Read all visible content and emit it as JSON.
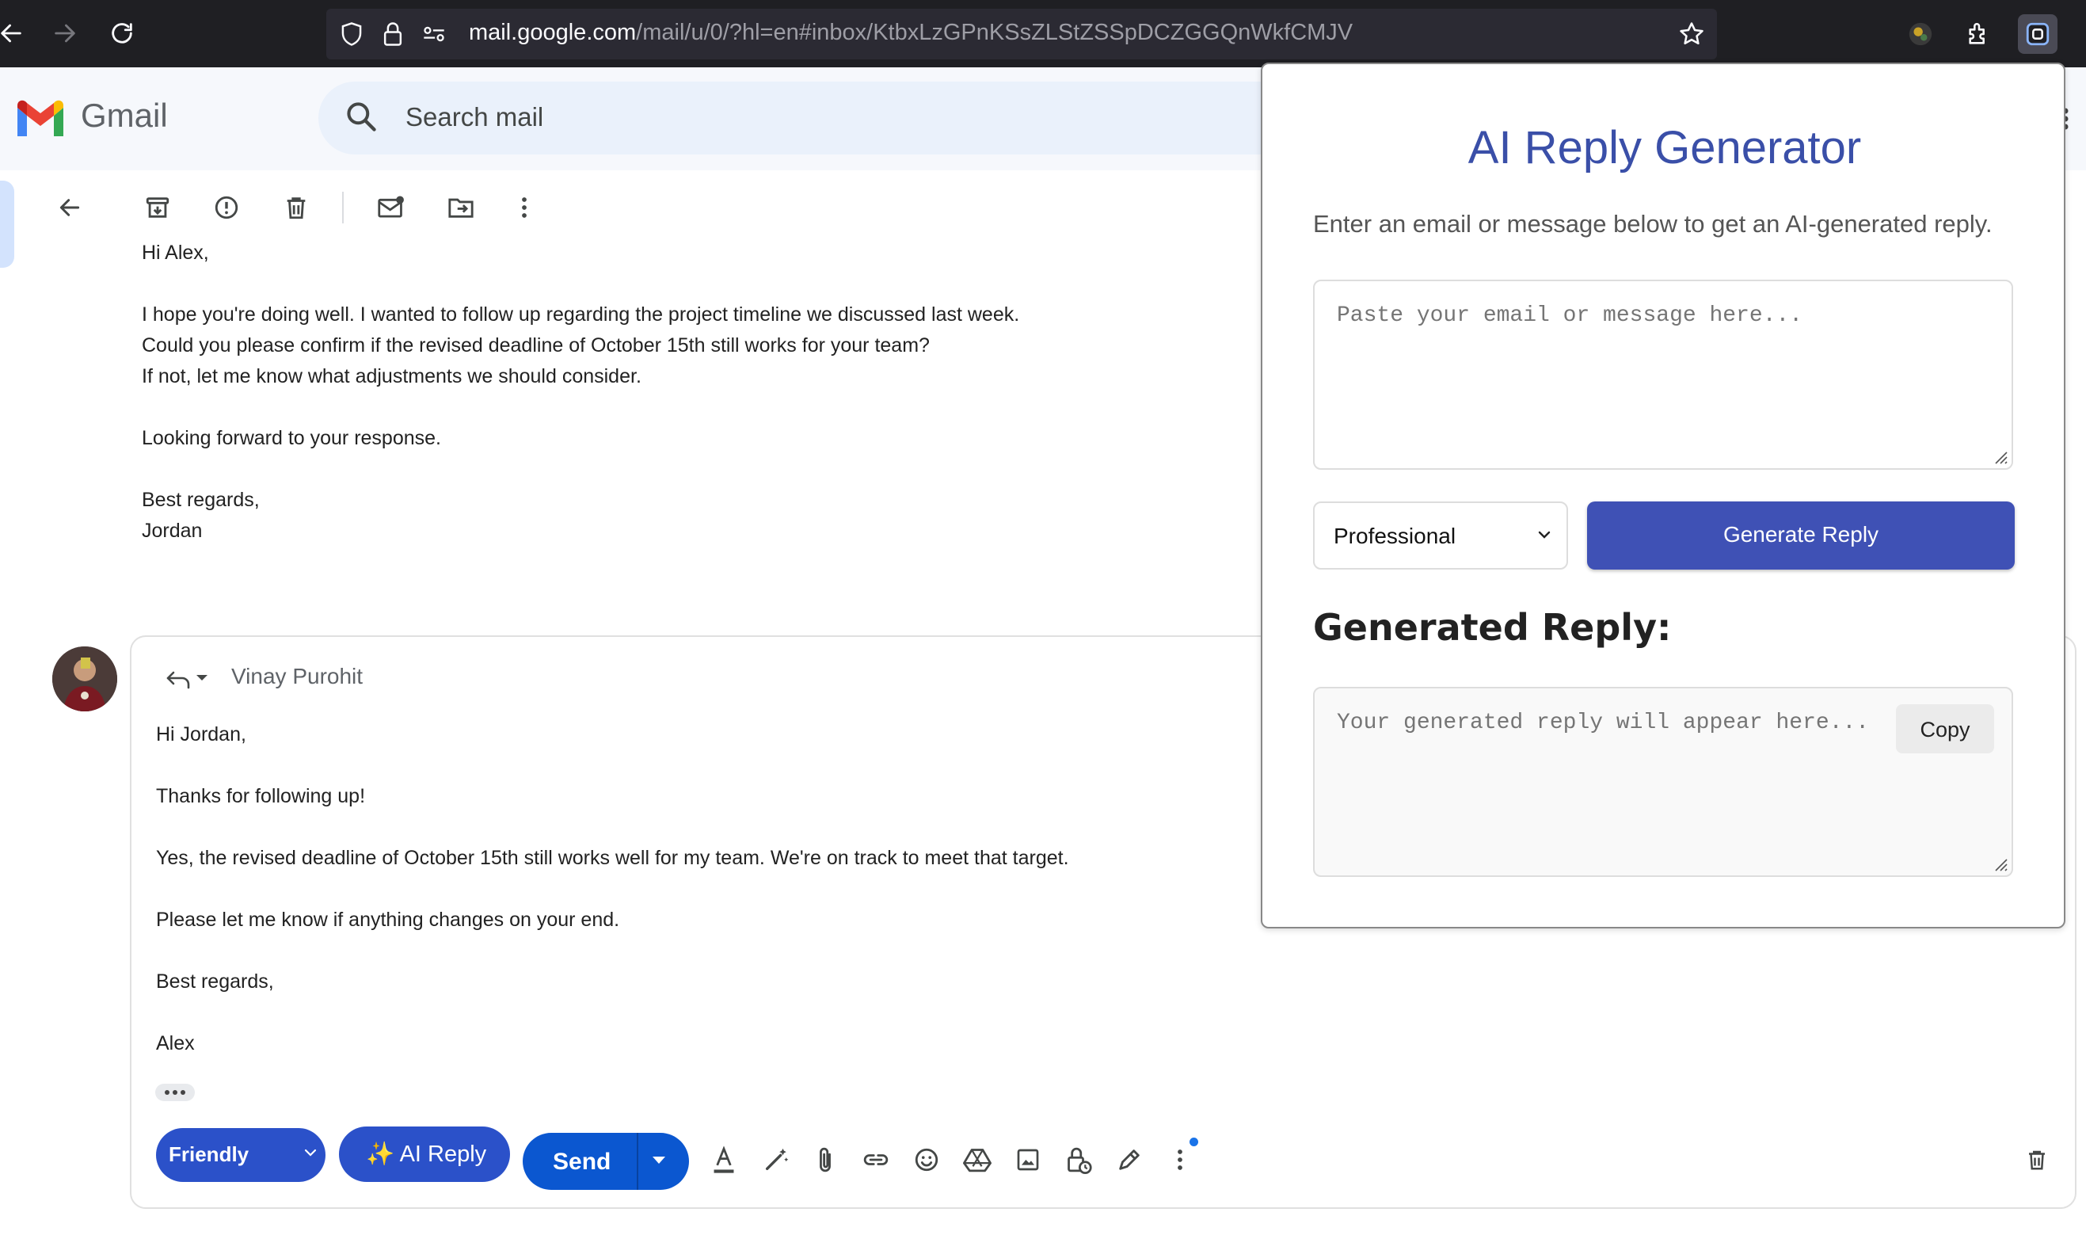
{
  "browser": {
    "url_host": "mail.google.com",
    "url_path": "/mail/u/0/?hl=en#inbox/KtbxLzGPnKSsZLStZSSpDCZGGQnWkfCMJV"
  },
  "gmail": {
    "logo_text": "Gmail",
    "search_placeholder": "Search mail"
  },
  "email": {
    "lines": [
      "Hi Alex,",
      "",
      "I hope you're doing well. I wanted to follow up regarding the project timeline we discussed last week.",
      "Could you please confirm if the revised deadline of October 15th still works for your team?",
      "If not, let me know what adjustments we should consider.",
      "",
      "Looking forward to your response.",
      "",
      "Best regards,",
      "Jordan"
    ]
  },
  "reply": {
    "recipient": "Vinay Purohit",
    "lines": [
      "Hi Jordan,",
      "",
      "Thanks for following up!",
      "",
      "Yes, the revised deadline of October 15th still works well for my team. We're on track to meet that target.",
      "",
      "Please let me know if anything changes on your end.",
      "",
      "Best regards,",
      "",
      "Alex"
    ],
    "tone_label": "Friendly",
    "ai_reply_label": "✨ AI Reply",
    "send_label": "Send"
  },
  "popup": {
    "title": "AI Reply Generator",
    "subtitle": "Enter an email or message below to get an AI-generated reply.",
    "input_placeholder": "Paste your email or message here...",
    "tone_selected": "Professional",
    "generate_label": "Generate Reply",
    "generated_title": "Generated Reply:",
    "output_placeholder": "Your generated reply will appear here...",
    "copy_label": "Copy"
  },
  "colors": {
    "accent": "#3f51b5",
    "popup_title": "#3a4fa8",
    "gmail_blue": "#0b57d0",
    "pill_blue": "#2b51c9"
  }
}
